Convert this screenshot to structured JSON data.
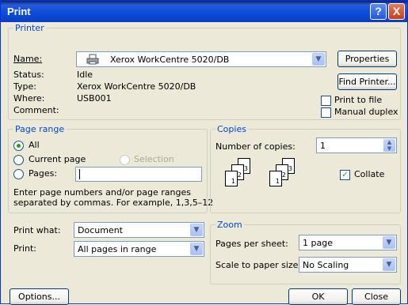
{
  "window": {
    "title": "Print",
    "help_label": "?",
    "close_label": "X"
  },
  "printer": {
    "group_label": "Printer",
    "name_label": "Name:",
    "name_value": "Xerox WorkCentre 5020/DB",
    "status_label": "Status:",
    "status_value": "Idle",
    "type_label": "Type:",
    "type_value": "Xerox WorkCentre 5020/DB",
    "where_label": "Where:",
    "where_value": "USB001",
    "comment_label": "Comment:",
    "properties_button": "Properties",
    "find_printer_button": "Find Printer...",
    "print_to_file_label": "Print to file",
    "manual_duplex_label": "Manual duplex"
  },
  "page_range": {
    "group_label": "Page range",
    "all_label": "All",
    "current_page_label": "Current page",
    "selection_label": "Selection",
    "pages_label": "Pages:",
    "hint_line1": "Enter page numbers and/or page ranges",
    "hint_line2": "separated by commas.  For example, 1,3,5–12"
  },
  "copies": {
    "group_label": "Copies",
    "number_label": "Number of copies:",
    "number_value": "1",
    "collate_label": "Collate",
    "page_numbers": [
      "1",
      "2",
      "3"
    ]
  },
  "print_what": {
    "label": "Print what:",
    "value": "Document"
  },
  "print": {
    "label": "Print:",
    "value": "All pages in range"
  },
  "zoom": {
    "group_label": "Zoom",
    "pages_per_sheet_label": "Pages per sheet:",
    "pages_per_sheet_value": "1 page",
    "scale_label": "Scale to paper size:",
    "scale_value": "No Scaling"
  },
  "buttons": {
    "options": "Options...",
    "ok": "OK",
    "close": "Close"
  }
}
